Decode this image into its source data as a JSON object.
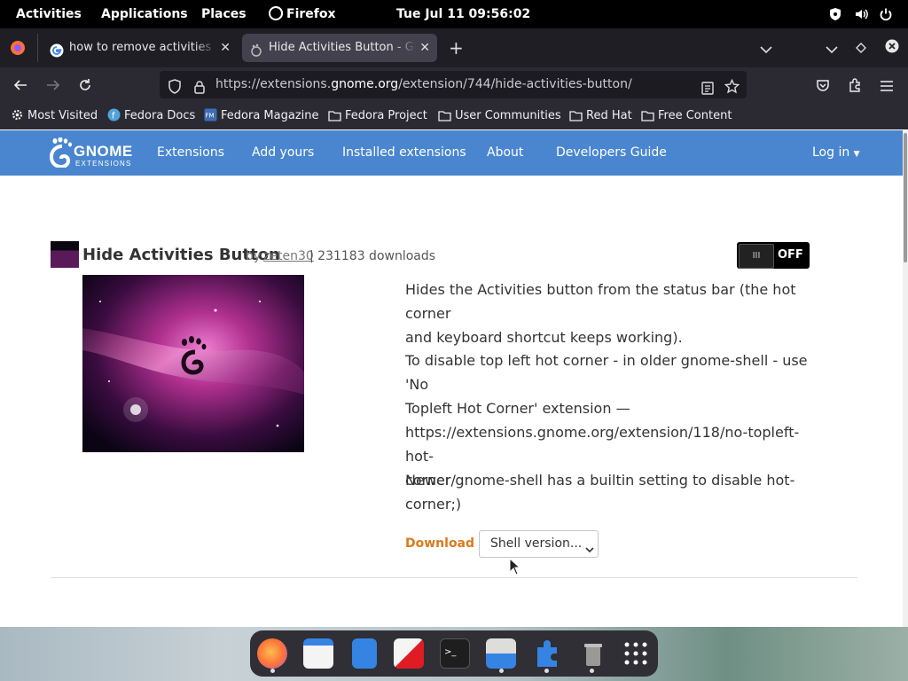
{
  "topbar": {
    "activities": "Activities",
    "applications": "Applications",
    "places": "Places",
    "app_name": "Firefox",
    "datetime": "Tue Jul 11  09:56:02"
  },
  "tabs": [
    {
      "title": "how to remove activities gnome"
    },
    {
      "title": "Hide Activities Button - GNOME"
    }
  ],
  "url": {
    "prefix": "https://extensions.",
    "domain": "gnome.org",
    "path": "/extension/744/hide-activities-button/"
  },
  "bookmarks": [
    "Most Visited",
    "Fedora Docs",
    "Fedora Magazine",
    "Fedora Project",
    "User Communities",
    "Red Hat",
    "Free Content"
  ],
  "site_nav": {
    "logo_top": "GNOME",
    "logo_bottom": "EXTENSIONS",
    "items": [
      "Extensions",
      "Add yours",
      "Installed extensions",
      "About",
      "Developers Guide"
    ],
    "login": "Log in"
  },
  "extension": {
    "name": "Hide Activities Button",
    "by": "by",
    "author": "zeten30",
    "downloads": "| 231183 downloads",
    "toggle_on": "III",
    "toggle_off": "OFF",
    "description": [
      [
        "Hides the Activities button from the status bar (the hot corner",
        "and keyboard shortcut keeps working)."
      ],
      [
        "To disable top left hot corner - in older gnome-shell - use 'No",
        "Topleft Hot Corner' extension —",
        "https://extensions.gnome.org/extension/118/no-topleft-hot-",
        "corner/ ."
      ],
      [
        "Newer gnome-shell has a builtin setting to disable hot-",
        "corner;)"
      ]
    ],
    "download_label": "Download",
    "shell_version": "Shell version..."
  },
  "colors": {
    "header_blue": "#4a86cf",
    "download_orange": "#d97b1b",
    "topbar": "#000000"
  }
}
